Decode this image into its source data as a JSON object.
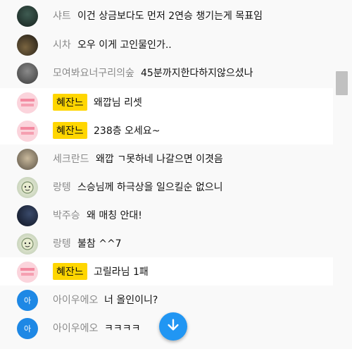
{
  "colors": {
    "accent": "#2196f3",
    "owner_badge": "#ffd600"
  },
  "messages": [
    {
      "author": "샤트",
      "text": "이건 상금보다도 먼저 2연승 챙기는게 목표임",
      "avatar": "photo-avatar-dark-green",
      "highlight": false,
      "owner": false
    },
    {
      "author": "시차",
      "text": "오우 이게 고인물인가..",
      "avatar": "photo-avatar-dark-room",
      "highlight": false,
      "owner": false
    },
    {
      "author": "모여봐요너구리의숲",
      "text": "45분까지한다하지않으셨나",
      "avatar": "photo-avatar-gray-person",
      "highlight": false,
      "owner": false
    },
    {
      "author": "혜잔느",
      "text": "왜깝님 리셋",
      "avatar": "pink-logo-avatar",
      "highlight": true,
      "owner": true
    },
    {
      "author": "혜잔느",
      "text": "238층 오세요~",
      "avatar": "pink-logo-avatar",
      "highlight": true,
      "owner": true
    },
    {
      "author": "세크란드",
      "text": "왜깝 ㄱ못하네 나갈으면 이겻음",
      "avatar": "photo-avatar-light-figure",
      "highlight": false,
      "owner": false
    },
    {
      "author": "랑텡",
      "text": "스승님께 하극상을 일으킬순 없으니",
      "avatar": "character-avatar",
      "highlight": false,
      "owner": false
    },
    {
      "author": "박주승",
      "text": "왜 매칭 안대!",
      "avatar": "photo-avatar-night-sky",
      "highlight": false,
      "owner": false
    },
    {
      "author": "랑텡",
      "text": "불참 ^^7",
      "avatar": "character-avatar",
      "highlight": false,
      "owner": false
    },
    {
      "author": "혜잔느",
      "text": "고릴라님 1패",
      "avatar": "pink-logo-avatar",
      "highlight": true,
      "owner": true
    },
    {
      "author": "아이우에오",
      "text": "너 올인이니?",
      "avatar": "initial-avatar",
      "initial": "아",
      "highlight": false,
      "owner": false
    },
    {
      "author": "아이우에오",
      "text": "ㅋㅋㅋㅋ",
      "avatar": "initial-avatar",
      "initial": "아",
      "highlight": false,
      "owner": false
    }
  ]
}
